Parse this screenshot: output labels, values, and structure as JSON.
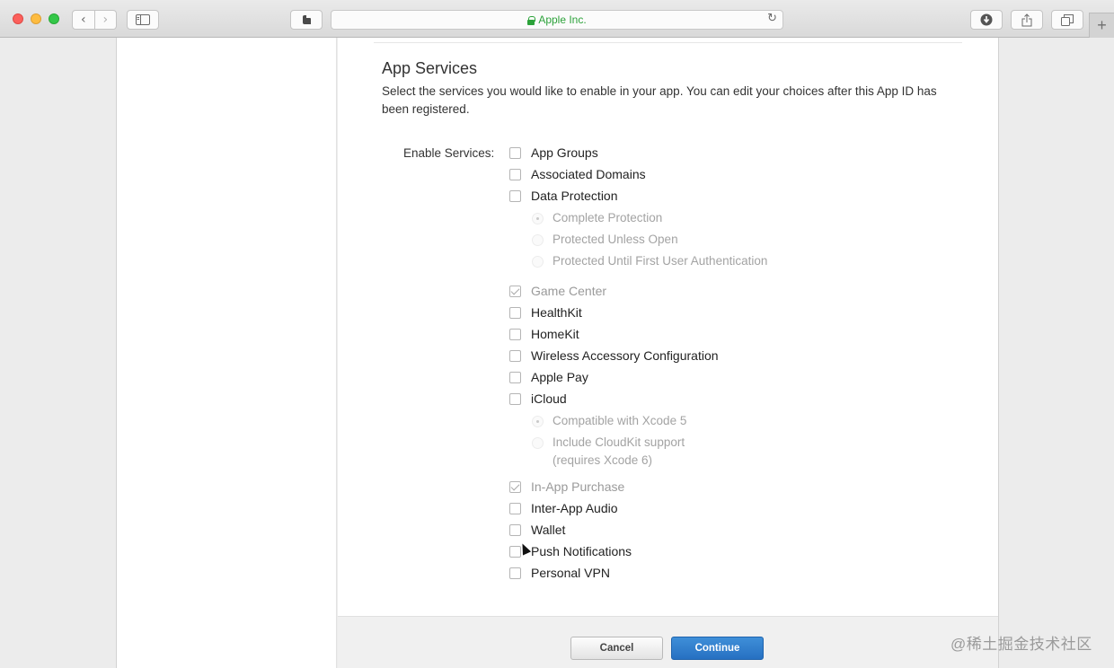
{
  "browser": {
    "url": "Apple Inc.",
    "new_tab_symbol": "+"
  },
  "section": {
    "title": "App Services",
    "description": "Select the services you would like to enable in your app. You can edit your choices after this App ID has been registered.",
    "enable_label": "Enable Services:"
  },
  "services": [
    {
      "label": "App Groups",
      "checked": false,
      "disabled": false
    },
    {
      "label": "Associated Domains",
      "checked": false,
      "disabled": false
    },
    {
      "label": "Data Protection",
      "checked": false,
      "disabled": false
    },
    {
      "label": "Game Center",
      "checked": true,
      "disabled": true
    },
    {
      "label": "HealthKit",
      "checked": false,
      "disabled": false
    },
    {
      "label": "HomeKit",
      "checked": false,
      "disabled": false
    },
    {
      "label": "Wireless Accessory Configuration",
      "checked": false,
      "disabled": false
    },
    {
      "label": "Apple Pay",
      "checked": false,
      "disabled": false
    },
    {
      "label": "iCloud",
      "checked": false,
      "disabled": false
    },
    {
      "label": "In-App Purchase",
      "checked": true,
      "disabled": true
    },
    {
      "label": "Inter-App Audio",
      "checked": false,
      "disabled": false
    },
    {
      "label": "Wallet",
      "checked": false,
      "disabled": false
    },
    {
      "label": "Push Notifications",
      "checked": false,
      "disabled": false
    },
    {
      "label": "Personal VPN",
      "checked": false,
      "disabled": false
    }
  ],
  "data_protection_options": [
    {
      "label": "Complete Protection",
      "selected": true
    },
    {
      "label": "Protected Unless Open",
      "selected": false
    },
    {
      "label": "Protected Until First User Authentication",
      "selected": false
    }
  ],
  "icloud_options": [
    {
      "label": "Compatible with Xcode 5",
      "selected": true
    },
    {
      "label": "Include CloudKit support",
      "sublabel": "(requires Xcode 6)",
      "selected": false
    }
  ],
  "footer": {
    "cancel_label": "Cancel",
    "continue_label": "Continue"
  },
  "watermark": "@稀土掘金技术社区"
}
